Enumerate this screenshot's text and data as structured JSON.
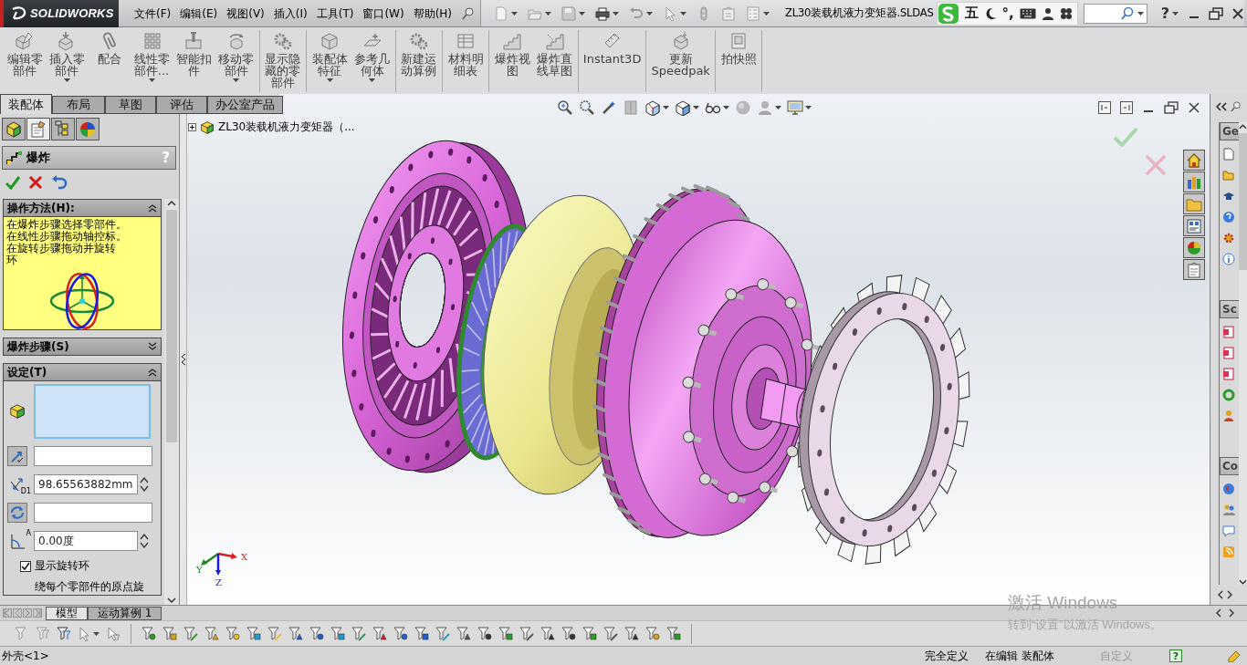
{
  "titlebar": {
    "logo": "SOLIDWORKS",
    "menu": [
      "文件(F)",
      "编辑(E)",
      "视图(V)",
      "插入(I)",
      "工具(T)",
      "窗口(W)",
      "帮助(H)"
    ],
    "quick_access": [
      {
        "dropdown": true
      },
      {
        "dropdown": true
      },
      {
        "dropdown": true
      },
      {
        "dropdown": true
      },
      {
        "dropdown": true
      },
      {
        "dropdown": true
      },
      {
        "dropdown": false
      },
      {
        "dropdown": false
      },
      {
        "dropdown": true
      }
    ],
    "title": "ZL30装载机液力变矩器.SLDAS",
    "ime": [
      "五",
      "°,"
    ],
    "help": "?"
  },
  "command_groups": [
    [
      {
        "label": "编辑零部件",
        "dropdown": false
      },
      {
        "label": "插入零部件",
        "dropdown": true
      },
      {
        "label": "配合",
        "dropdown": false
      },
      {
        "label": "线性零部件...",
        "dropdown": true
      },
      {
        "label": "智能扣件",
        "dropdown": false
      },
      {
        "label": "移动零部件",
        "dropdown": true
      }
    ],
    [
      {
        "label": "显示隐藏的零部件",
        "dropdown": false
      }
    ],
    [
      {
        "label": "装配体特征",
        "dropdown": true
      },
      {
        "label": "参考几何体",
        "dropdown": true
      }
    ],
    [
      {
        "label": "新建运动算例",
        "dropdown": false
      }
    ],
    [
      {
        "label": "材料明细表",
        "dropdown": false
      }
    ],
    [
      {
        "label": "爆炸视图",
        "dropdown": false
      },
      {
        "label": "爆炸直线草图",
        "dropdown": false
      }
    ],
    [
      {
        "label": "Instant3D",
        "dropdown": false
      }
    ],
    [
      {
        "label": "更新Speedpak",
        "dropdown": false
      }
    ],
    [
      {
        "label": "拍快照",
        "dropdown": false
      }
    ]
  ],
  "command_tabs": [
    {
      "label": "装配体",
      "selected": true
    },
    {
      "label": "布局",
      "selected": false
    },
    {
      "label": "草图",
      "selected": false
    },
    {
      "label": "评估",
      "selected": false
    },
    {
      "label": "办公室产品",
      "selected": false
    }
  ],
  "panel_tabs": [
    {
      "selected": false
    },
    {
      "selected": true
    },
    {
      "selected": false
    },
    {
      "selected": false
    }
  ],
  "property_manager": {
    "title": "爆炸",
    "help": "?",
    "sections": [
      {
        "kind": "message",
        "title": "操作方法(H):",
        "expanded": true,
        "lines": [
          "在爆炸步骤选择零部件。",
          "在线性步骤拖动轴控标。",
          "在旋转步骤拖动并旋转",
          "环"
        ]
      },
      {
        "title": "爆炸步骤(S)",
        "expanded": false
      },
      {
        "kind": "settings",
        "title": "设定(T)",
        "expanded": true,
        "items": [
          {
            "kind": "list"
          },
          {
            "kind": "field"
          },
          {
            "kind": "spin",
            "icon_text": "D1",
            "value": "98.65563882mm"
          },
          {
            "kind": "field"
          },
          {
            "kind": "spin",
            "icon_text": "A",
            "value": "0.00度"
          },
          {
            "kind": "checkbox",
            "label": "显示旋转环",
            "checked": true
          },
          {
            "kind": "text",
            "text": "绕每个零部件的原点旋"
          }
        ]
      }
    ]
  },
  "feature_tree": {
    "root": "ZL30装载机液力变矩器（...",
    "expanded": false
  },
  "triad": {
    "labels": [
      "X",
      "Y",
      "Z"
    ]
  },
  "task_pane": {
    "sections": [
      "Ge",
      "Sc",
      "Co"
    ]
  },
  "bottom_tabs": [
    {
      "label": "模型",
      "selected": true
    },
    {
      "label": "运动算例 1",
      "selected": false
    }
  ],
  "status_bar": {
    "items": [
      {
        "text": "外壳<1>",
        "disabled": false
      },
      {
        "text": "完全定义",
        "disabled": false
      },
      {
        "text": "在编辑 装配体",
        "disabled": false
      },
      {
        "text": "自定义",
        "disabled": true
      }
    ],
    "help": "?"
  },
  "activation_notice": {
    "title": "激活 Windows",
    "text": "转到“设置”以激活 Windows。"
  }
}
